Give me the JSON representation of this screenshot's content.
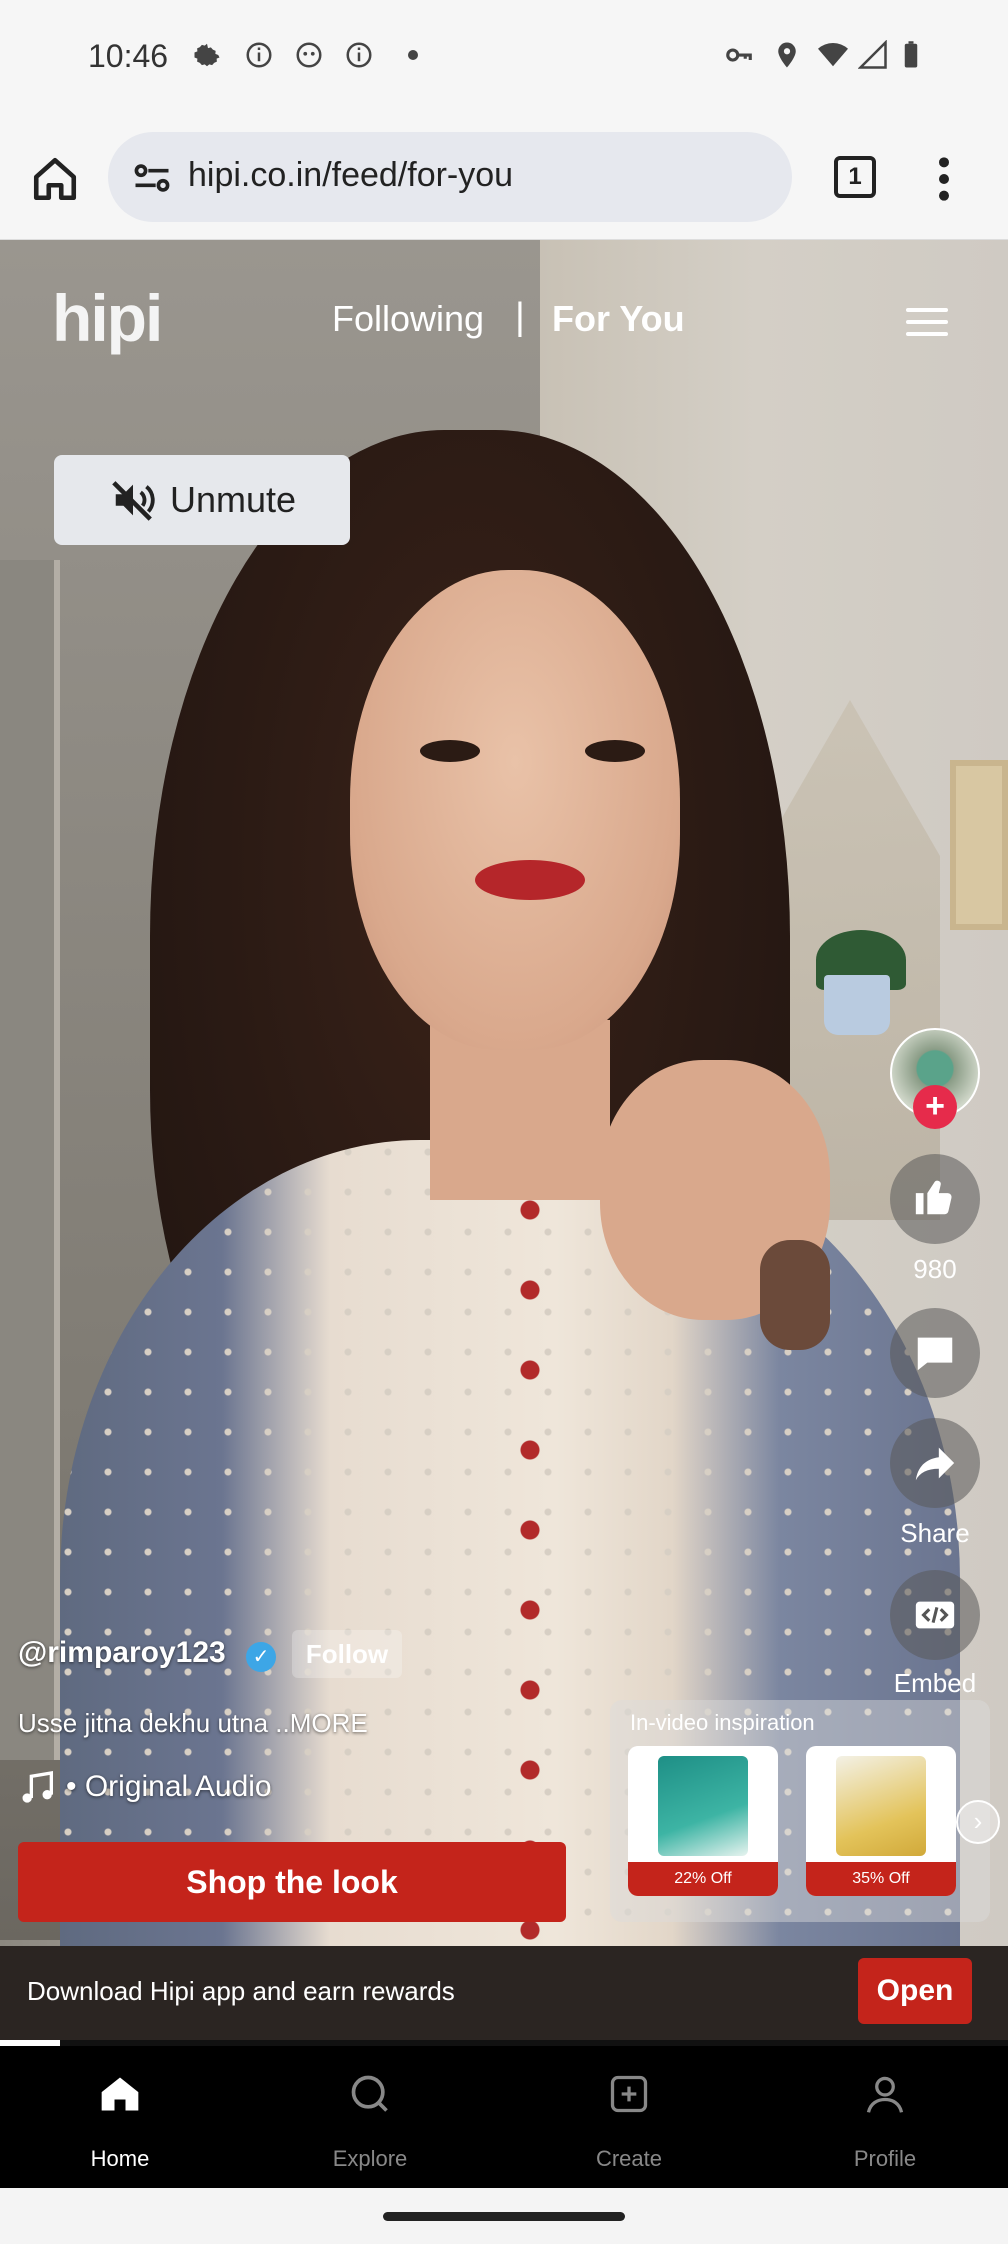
{
  "status_bar": {
    "time": "10:46",
    "icons": [
      "gear-icon",
      "info-icon",
      "face-icon",
      "info-icon",
      "dot-icon",
      "key-icon",
      "location-icon",
      "wifi-icon",
      "signal-icon",
      "battery-icon"
    ]
  },
  "browser": {
    "url": "hipi.co.in/feed/for-you",
    "tab_count": "1"
  },
  "top_nav": {
    "logo": "hipi",
    "tabs": [
      {
        "label": "Following",
        "active": false
      },
      {
        "label": "For You",
        "active": true
      }
    ],
    "separator": "|"
  },
  "unmute_label": "Unmute",
  "rail": {
    "likes": "980",
    "share_label": "Share",
    "embed_label": "Embed"
  },
  "post": {
    "username": "@rimparoy123",
    "follow_label": "Follow",
    "caption": "Usse jitna dekhu utna ..MORE",
    "audio": "• Original Audio",
    "shop_label": "Shop the look"
  },
  "inspiration": {
    "title": "In-video inspiration",
    "products": [
      {
        "discount": "22% Off",
        "color": "#2a9a8a"
      },
      {
        "discount": "35% Off",
        "color": "#e3c35a"
      }
    ]
  },
  "banner": {
    "text": "Download Hipi app and earn rewards",
    "open_label": "Open"
  },
  "progress_fraction": 0.06,
  "bottom_nav": [
    {
      "label": "Home",
      "icon": "home-icon",
      "active": true
    },
    {
      "label": "Explore",
      "icon": "search-icon",
      "active": false
    },
    {
      "label": "Create",
      "icon": "plus-square-icon",
      "active": false
    },
    {
      "label": "Profile",
      "icon": "person-icon",
      "active": false
    }
  ],
  "colors": {
    "accent": "#c4241b",
    "verified": "#3da6e6",
    "follow_plus": "#e62b4b"
  }
}
